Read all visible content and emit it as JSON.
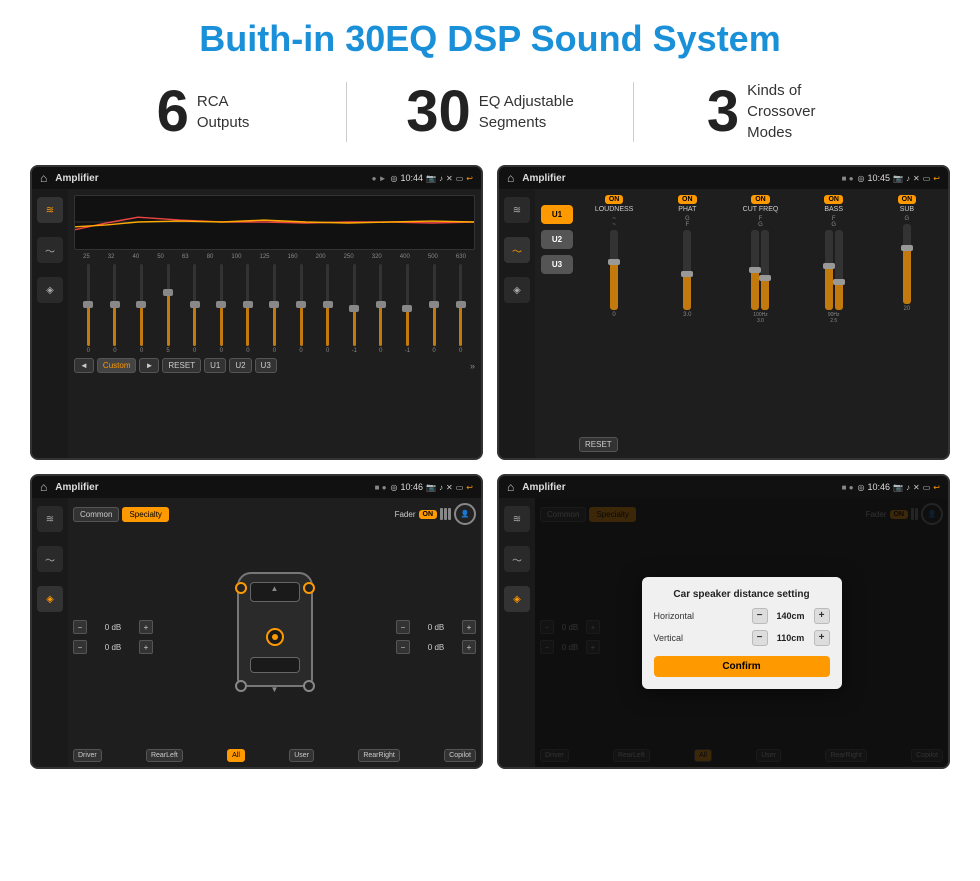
{
  "page": {
    "title": "Buith-in 30EQ DSP Sound System"
  },
  "stats": [
    {
      "number": "6",
      "text_line1": "RCA",
      "text_line2": "Outputs"
    },
    {
      "number": "30",
      "text_line1": "EQ Adjustable",
      "text_line2": "Segments"
    },
    {
      "number": "3",
      "text_line1": "Kinds of",
      "text_line2": "Crossover Modes"
    }
  ],
  "screen1": {
    "status": {
      "title": "Amplifier",
      "time": "10:44"
    },
    "eq_freqs": [
      "25",
      "32",
      "40",
      "50",
      "63",
      "80",
      "100",
      "125",
      "160",
      "200",
      "250",
      "320",
      "400",
      "500",
      "630"
    ],
    "eq_values": [
      "0",
      "0",
      "0",
      "5",
      "0",
      "0",
      "0",
      "0",
      "0",
      "0",
      "-1",
      "0",
      "-1",
      "",
      ""
    ],
    "controls": [
      "◄",
      "Custom",
      "►",
      "RESET",
      "U1",
      "U2",
      "U3"
    ]
  },
  "screen2": {
    "status": {
      "title": "Amplifier",
      "time": "10:45"
    },
    "presets": [
      "U1",
      "U2",
      "U3"
    ],
    "channels": [
      "LOUDNESS",
      "PHAT",
      "CUT FREQ",
      "BASS",
      "SUB"
    ],
    "reset_label": "RESET"
  },
  "screen3": {
    "status": {
      "title": "Amplifier",
      "time": "10:46"
    },
    "tabs": [
      "Common",
      "Specialty"
    ],
    "fader_label": "Fader",
    "fader_on": "ON",
    "volumes": [
      "0 dB",
      "0 dB",
      "0 dB",
      "0 dB"
    ],
    "buttons": [
      "Driver",
      "RearLeft",
      "All",
      "User",
      "RearRight",
      "Copilot"
    ]
  },
  "screen4": {
    "status": {
      "title": "Amplifier",
      "time": "10:46"
    },
    "tabs": [
      "Common",
      "Specialty"
    ],
    "dialog": {
      "title": "Car speaker distance setting",
      "horizontal_label": "Horizontal",
      "horizontal_value": "140cm",
      "vertical_label": "Vertical",
      "vertical_value": "110cm",
      "confirm_label": "Confirm"
    },
    "volumes": [
      "0 dB",
      "0 dB"
    ],
    "buttons": [
      "Driver",
      "RearLeft",
      "All",
      "User",
      "RearRight",
      "Copilot"
    ]
  },
  "icons": {
    "home": "⌂",
    "back": "↩",
    "location": "◎",
    "camera": "◉",
    "volume": "♪",
    "close": "✕",
    "window": "▭",
    "eq_icon": "≋",
    "wave_icon": "〜",
    "speaker_icon": "◈",
    "minus": "−",
    "plus": "+"
  }
}
